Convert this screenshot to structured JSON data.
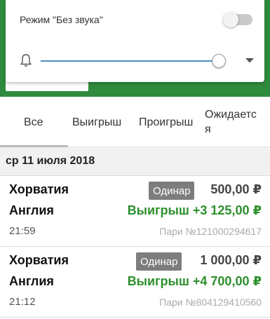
{
  "volume_panel": {
    "dnd_label": "Режим \"Без звука\"",
    "dnd_enabled": false,
    "volume_level": 0.94
  },
  "tabs": [
    {
      "label": "Все",
      "selected": true
    },
    {
      "label": "Выигрыш",
      "selected": false
    },
    {
      "label": "Проигрыш",
      "selected": false
    },
    {
      "label": "Ожидается",
      "selected": false
    }
  ],
  "date_header": "ср 11 июля 2018",
  "bets": [
    {
      "team1": "Хорватия",
      "team2": "Англия",
      "time": "21:59",
      "type": "Одинар",
      "stake": "500,00 ₽",
      "result": "Выигрыш +3 125,00 ₽",
      "bet_id": "Пари №121000294617"
    },
    {
      "team1": "Хорватия",
      "team2": "Англия",
      "time": "21:12",
      "type": "Одинар",
      "stake": "1 000,00 ₽",
      "result": "Выигрыш +4 700,00 ₽",
      "bet_id": "Пари №804129410560"
    }
  ],
  "colors": {
    "header_green": "#2f8a3d",
    "win_green": "#2d8f2d",
    "slider_blue": "#4a8fc4",
    "badge_gray": "#7d7d7d"
  }
}
